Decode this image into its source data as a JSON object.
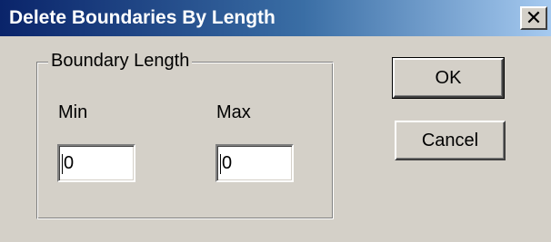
{
  "dialog": {
    "title": "Delete Boundaries By Length",
    "close_glyph": "✕",
    "group": {
      "legend": "Boundary Length",
      "min": {
        "label": "Min",
        "value": "0"
      },
      "max": {
        "label": "Max",
        "value": "0"
      }
    },
    "buttons": {
      "ok_label": "OK",
      "cancel_label": "Cancel"
    }
  },
  "icons": {
    "close": "close-icon"
  },
  "colors": {
    "titlebar_start": "#0a246a",
    "titlebar_end": "#a6caf0",
    "dialog_face": "#d4d0c8"
  }
}
